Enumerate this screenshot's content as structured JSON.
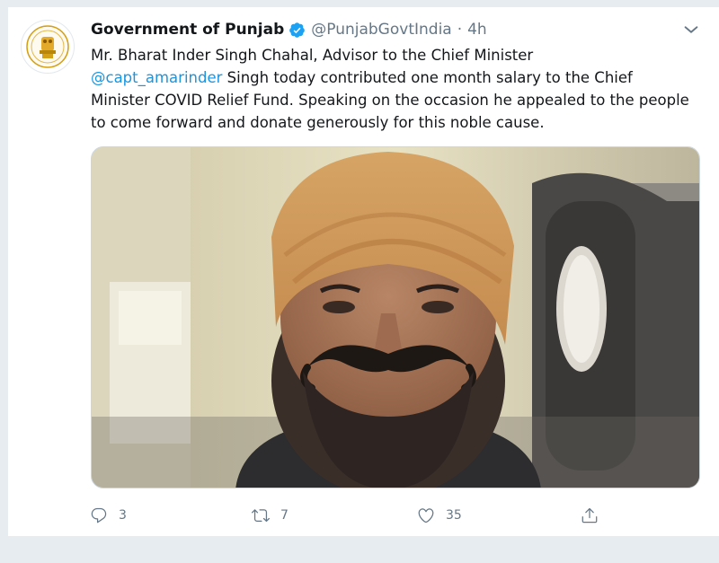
{
  "tweet": {
    "display_name": "Government of Punjab",
    "handle": "@PunjabGovtIndia",
    "separator": "·",
    "time": "4h",
    "text_line1": "Mr. Bharat Inder Singh Chahal,  Advisor to the Chief Minister",
    "mention": "@capt_amarinder",
    "text_after_mention": " Singh today contributed one month salary to the Chief Minister COVID Relief Fund. Speaking on the occasion he appealed to the people to come forward and donate generously for this noble cause."
  },
  "actions": {
    "reply_count": "3",
    "retweet_count": "7",
    "like_count": "35"
  },
  "colors": {
    "accent": "#1b95e0",
    "text": "#14171a",
    "muted": "#657786",
    "verified": "#1da1f2"
  },
  "icons": [
    "verified-badge-icon",
    "caret-down-icon",
    "reply-icon",
    "retweet-icon",
    "like-icon",
    "share-icon"
  ]
}
